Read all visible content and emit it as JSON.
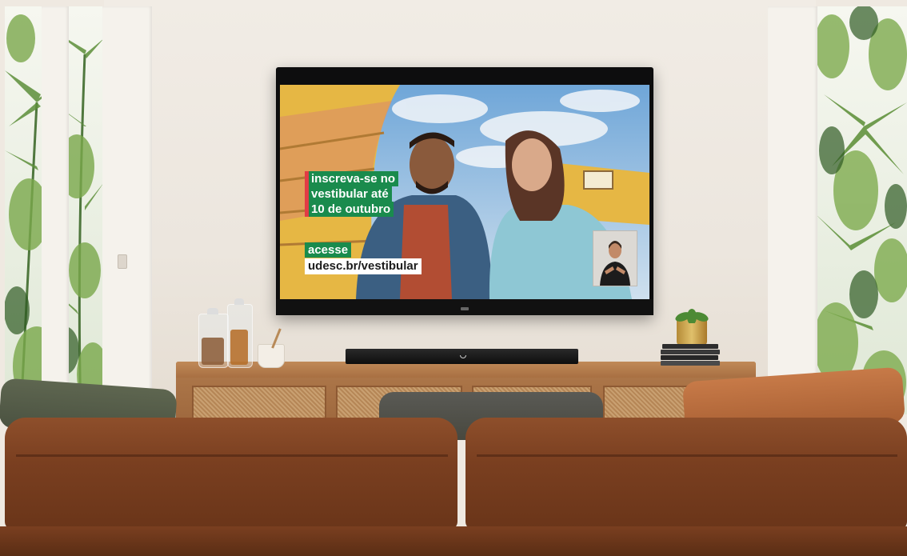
{
  "tv": {
    "caption_lines": [
      "inscreva-se no",
      "vestibular até",
      "10 de outubro"
    ],
    "cta_label": "acesse",
    "cta_url": "udesc.br/vestibular",
    "brand_color": "#1a8b4d",
    "accent_color": "#e23c45"
  }
}
